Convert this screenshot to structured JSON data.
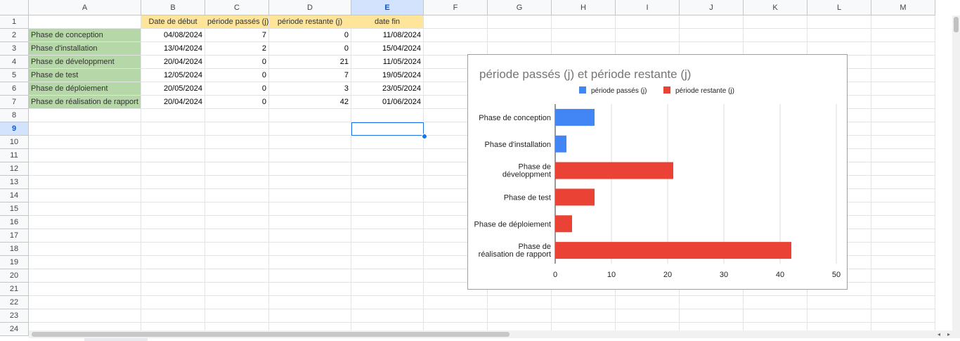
{
  "columns": [
    "A",
    "B",
    "C",
    "D",
    "E",
    "F",
    "G",
    "H",
    "I",
    "J",
    "K",
    "L",
    "M"
  ],
  "selected_column": "E",
  "row_numbers": [
    "1",
    "2",
    "3",
    "4",
    "5",
    "6",
    "7",
    "8",
    "9",
    "10",
    "11",
    "12",
    "13",
    "14",
    "15",
    "16",
    "17",
    "18",
    "19",
    "20",
    "21",
    "22",
    "23",
    "24"
  ],
  "selected_row": "9",
  "table": {
    "headers": [
      "",
      "Date de début",
      "période passés (j)",
      "période restante (j)",
      "date fin"
    ],
    "rows": [
      [
        "Phase de conception",
        "04/08/2024",
        "7",
        "0",
        "11/08/2024"
      ],
      [
        "Phase d'installation",
        "13/04/2024",
        "2",
        "0",
        "15/04/2024"
      ],
      [
        "Phase de développment",
        "20/04/2024",
        "0",
        "21",
        "11/05/2024"
      ],
      [
        "Phase de test",
        "12/05/2024",
        "0",
        "7",
        "19/05/2024"
      ],
      [
        "Phase de déploiement",
        "20/05/2024",
        "0",
        "3",
        "23/05/2024"
      ],
      [
        "Phase de réalisation de rapport",
        "20/04/2024",
        "0",
        "42",
        "01/06/2024"
      ]
    ]
  },
  "colors": {
    "header_fill": "#ffe599",
    "label_fill": "#b6d7a8",
    "selection": "#1a73e8",
    "series_passes": "#4285f4",
    "series_restante": "#ea4335"
  },
  "chart_data": {
    "type": "bar",
    "orientation": "horizontal",
    "stacked": true,
    "title": "période passés (j) et période restante (j)",
    "categories": [
      "Phase de conception",
      "Phase d'installation",
      "Phase de développment",
      "Phase de test",
      "Phase de déploiement",
      "Phase de réalisation de rapport"
    ],
    "series": [
      {
        "name": "période passés (j)",
        "values": [
          7,
          2,
          0,
          0,
          0,
          0
        ],
        "color": "#4285f4"
      },
      {
        "name": "période restante (j)",
        "values": [
          0,
          0,
          21,
          7,
          3,
          42
        ],
        "color": "#ea4335"
      }
    ],
    "xlim": [
      0,
      50
    ],
    "xticks": [
      0,
      10,
      20,
      30,
      40,
      50
    ],
    "grid": true,
    "legend": "top"
  }
}
